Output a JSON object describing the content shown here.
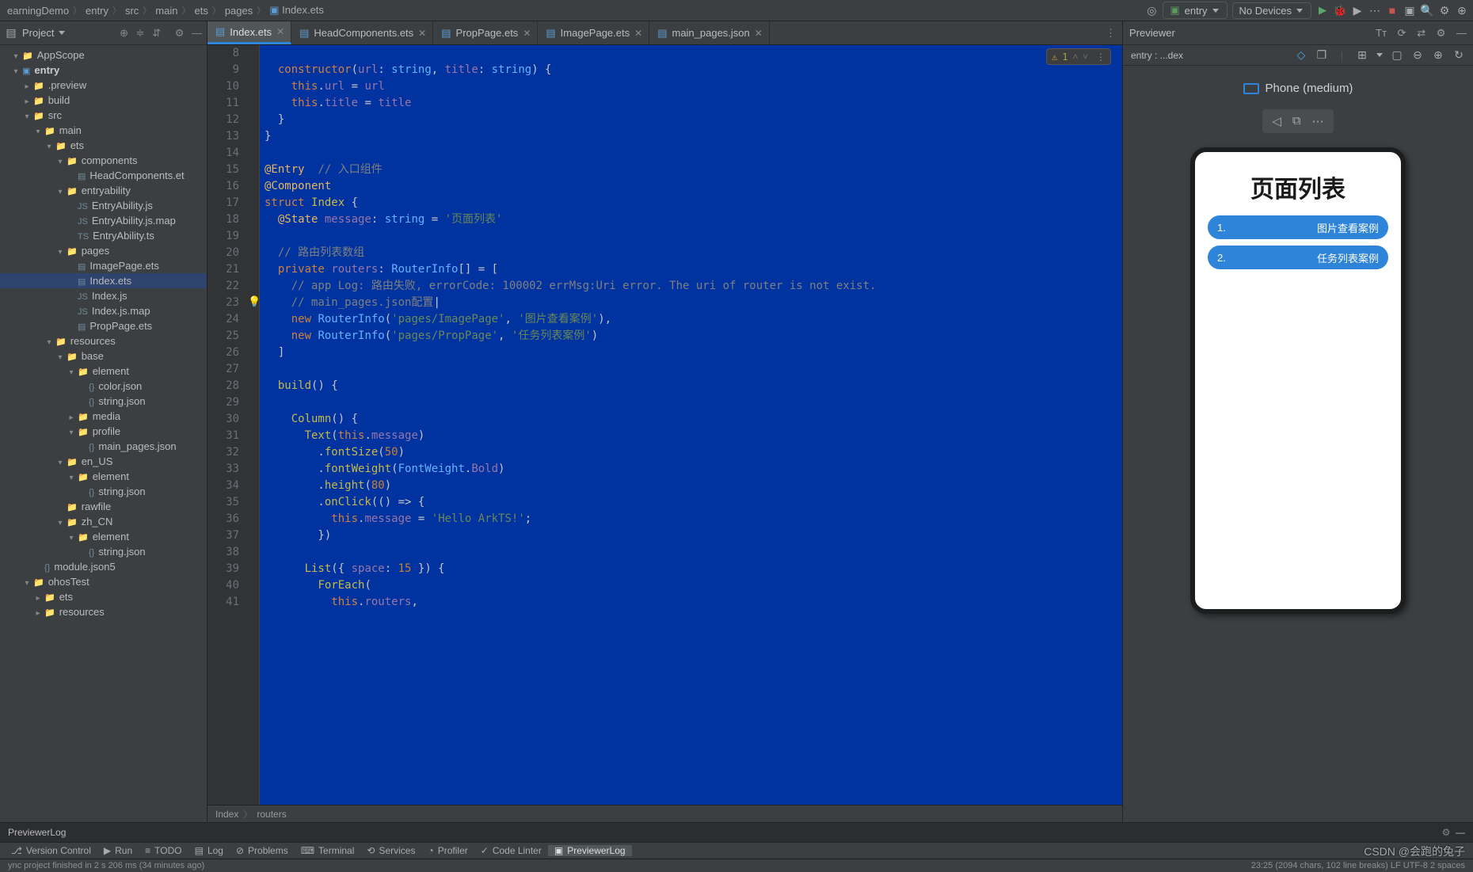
{
  "breadcrumb": [
    "earningDemo",
    "entry",
    "src",
    "main",
    "ets",
    "pages",
    "Index.ets"
  ],
  "runConfig": {
    "entry": "entry",
    "device": "No Devices"
  },
  "projectTool": {
    "title": "Project"
  },
  "tree": [
    {
      "d": 1,
      "exp": true,
      "icon": "dir",
      "label": "AppScope"
    },
    {
      "d": 1,
      "exp": true,
      "icon": "mod",
      "label": "entry",
      "bold": true
    },
    {
      "d": 2,
      "exp": false,
      "icon": "dir",
      "label": ".preview"
    },
    {
      "d": 2,
      "exp": false,
      "icon": "dir",
      "label": "build"
    },
    {
      "d": 2,
      "exp": true,
      "icon": "dir-blue",
      "label": "src"
    },
    {
      "d": 3,
      "exp": true,
      "icon": "dir-blue",
      "label": "main"
    },
    {
      "d": 4,
      "exp": true,
      "icon": "dir-blue",
      "label": "ets"
    },
    {
      "d": 5,
      "exp": true,
      "icon": "dir-blue",
      "label": "components"
    },
    {
      "d": 6,
      "exp": null,
      "icon": "ets",
      "label": "HeadComponents.et"
    },
    {
      "d": 5,
      "exp": true,
      "icon": "dir-blue",
      "label": "entryability"
    },
    {
      "d": 6,
      "exp": null,
      "icon": "js",
      "label": "EntryAbility.js"
    },
    {
      "d": 6,
      "exp": null,
      "icon": "js",
      "label": "EntryAbility.js.map"
    },
    {
      "d": 6,
      "exp": null,
      "icon": "ts",
      "label": "EntryAbility.ts"
    },
    {
      "d": 5,
      "exp": true,
      "icon": "dir-blue",
      "label": "pages"
    },
    {
      "d": 6,
      "exp": null,
      "icon": "ets",
      "label": "ImagePage.ets"
    },
    {
      "d": 6,
      "exp": null,
      "icon": "ets",
      "label": "Index.ets",
      "active": true
    },
    {
      "d": 6,
      "exp": null,
      "icon": "js",
      "label": "Index.js"
    },
    {
      "d": 6,
      "exp": null,
      "icon": "js",
      "label": "Index.js.map"
    },
    {
      "d": 6,
      "exp": null,
      "icon": "ets",
      "label": "PropPage.ets"
    },
    {
      "d": 4,
      "exp": true,
      "icon": "dir-blue",
      "label": "resources"
    },
    {
      "d": 5,
      "exp": true,
      "icon": "dir-blue",
      "label": "base"
    },
    {
      "d": 6,
      "exp": true,
      "icon": "dir-blue",
      "label": "element"
    },
    {
      "d": 7,
      "exp": null,
      "icon": "json",
      "label": "color.json"
    },
    {
      "d": 7,
      "exp": null,
      "icon": "json",
      "label": "string.json"
    },
    {
      "d": 6,
      "exp": false,
      "icon": "dir-blue",
      "label": "media"
    },
    {
      "d": 6,
      "exp": true,
      "icon": "dir-blue",
      "label": "profile"
    },
    {
      "d": 7,
      "exp": null,
      "icon": "json",
      "label": "main_pages.json"
    },
    {
      "d": 5,
      "exp": true,
      "icon": "dir-blue",
      "label": "en_US"
    },
    {
      "d": 6,
      "exp": true,
      "icon": "dir-blue",
      "label": "element"
    },
    {
      "d": 7,
      "exp": null,
      "icon": "json",
      "label": "string.json"
    },
    {
      "d": 5,
      "exp": null,
      "icon": "dir-blue",
      "label": "rawfile"
    },
    {
      "d": 5,
      "exp": true,
      "icon": "dir-blue",
      "label": "zh_CN"
    },
    {
      "d": 6,
      "exp": true,
      "icon": "dir-blue",
      "label": "element"
    },
    {
      "d": 7,
      "exp": null,
      "icon": "json",
      "label": "string.json"
    },
    {
      "d": 3,
      "exp": null,
      "icon": "json",
      "label": "module.json5"
    },
    {
      "d": 2,
      "exp": true,
      "icon": "dir-blue",
      "label": "ohosTest"
    },
    {
      "d": 3,
      "exp": false,
      "icon": "dir-blue",
      "label": "ets"
    },
    {
      "d": 3,
      "exp": false,
      "icon": "dir-blue",
      "label": "resources"
    }
  ],
  "tabs": [
    {
      "label": "Index.ets",
      "active": true
    },
    {
      "label": "HeadComponents.ets"
    },
    {
      "label": "PropPage.ets"
    },
    {
      "label": "ImagePage.ets"
    },
    {
      "label": "main_pages.json"
    }
  ],
  "inspection": {
    "warn": "1"
  },
  "code": {
    "startLine": 8,
    "bulbLine": 23,
    "lines": [
      "",
      "  <kw>constructor</kw>(<p>url</p>: <t>string</t>, <p>title</p>: <t>string</t>) {",
      "    <kw>this</kw>.<p>url</p> = <p>url</p>",
      "    <kw>this</kw>.<p>title</p> = <p>title</p>",
      "  }",
      "}",
      "",
      "<y>@Entry</y>  <c>// 入口组件</c>",
      "<y>@Component</y>",
      "<kw>struct</kw> <fn>Index</fn> {",
      "  <y>@State</y> <p>message</p>: <t>string</t> = <s>'页面列表'</s>",
      "",
      "  <c>// 路由列表数组</c>",
      "  <kw>private</kw> <p>routers</p>: <t>RouterInfo</t>[] = [",
      "    <c>// app Log: 路由失败, errorCode: 100002 errMsg:Uri error. The uri of router is not exist.</c>",
      "    <c>// main_pages.json配置</c><cur>|</cur>",
      "    <kw>new</kw> <t>RouterInfo</t>(<s>'pages/ImagePage'</s>, <s>'图片查看案例'</s>),",
      "    <kw>new</kw> <t>RouterInfo</t>(<s>'pages/PropPage'</s>, <s>'任务列表案例'</s>)",
      "  ]",
      "",
      "  <fn>build</fn>() {",
      "",
      "    <fn>Column</fn>() {",
      "      <fn>Text</fn>(<kw>this</kw>.<p>message</p>)",
      "        .<fn>fontSize</fn>(<n>50</n>)",
      "        .<fn>fontWeight</fn>(<t>FontWeight</t>.<p>Bold</p>)",
      "        .<fn>height</fn>(<n>80</n>)",
      "        .<fn>onClick</fn>(() => {",
      "          <kw>this</kw>.<p>message</p> = <s>'Hello ArkTS!'</s>;",
      "        })",
      "",
      "      <fn>List</fn>({ <p>space</p>: <n>15</n> }) {",
      "        <fn>ForEach</fn>(",
      "          <kw>this</kw>.<p>routers</p>,"
    ]
  },
  "editorCrumbs": [
    "Index",
    "routers"
  ],
  "previewer": {
    "title": "Previewer",
    "entry": "entry : ...dex",
    "device": "Phone (medium)",
    "page_title": "页面列表",
    "rows": [
      {
        "num": "1.",
        "label": "图片查看案例"
      },
      {
        "num": "2.",
        "label": "任务列表案例"
      }
    ]
  },
  "logPanel": {
    "title": "PreviewerLog"
  },
  "bottomTabs": [
    {
      "icon": "⎇",
      "label": "Version Control"
    },
    {
      "icon": "▶",
      "label": "Run"
    },
    {
      "icon": "≡",
      "label": "TODO"
    },
    {
      "icon": "▤",
      "label": "Log"
    },
    {
      "icon": "⊘",
      "label": "Problems"
    },
    {
      "icon": "⌨",
      "label": "Terminal"
    },
    {
      "icon": "⟲",
      "label": "Services"
    },
    {
      "icon": "◔",
      "label": "Profiler"
    },
    {
      "icon": "✓",
      "label": "Code Linter"
    },
    {
      "icon": "▣",
      "label": "PreviewerLog",
      "active": true
    }
  ],
  "status": {
    "left": "ync project finished in 2 s 206 ms (34 minutes ago)",
    "right": "23:25 (2094 chars, 102 line breaks)   LF   UTF-8   2 spaces"
  },
  "watermark": "CSDN @会跑的兔子"
}
